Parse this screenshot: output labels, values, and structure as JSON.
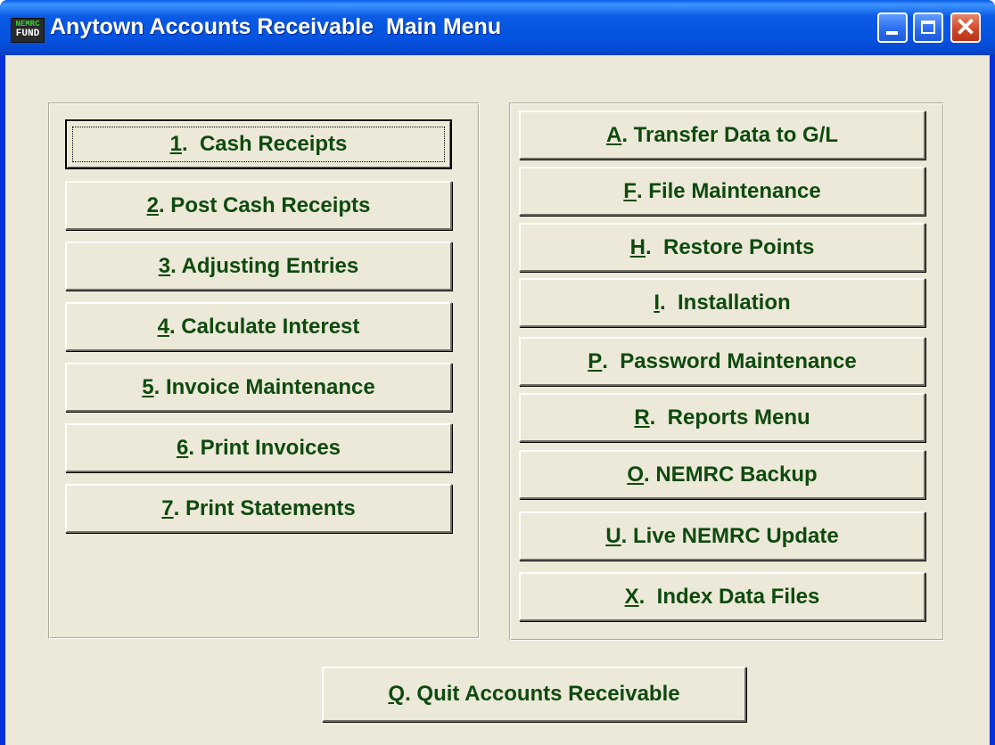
{
  "window": {
    "title": "Anytown Accounts Receivable  Main Menu",
    "icon_top": "NEMRC",
    "icon_bottom": "FUND"
  },
  "left_menu": [
    {
      "key": "1",
      "rest": ".  Cash Receipts"
    },
    {
      "key": "2",
      "rest": ". Post Cash Receipts"
    },
    {
      "key": "3",
      "rest": ". Adjusting Entries"
    },
    {
      "key": "4",
      "rest": ". Calculate Interest"
    },
    {
      "key": "5",
      "rest": ". Invoice Maintenance"
    },
    {
      "key": "6",
      "rest": ". Print Invoices"
    },
    {
      "key": "7",
      "rest": ". Print Statements"
    }
  ],
  "right_menu": [
    {
      "key": "A",
      "rest": ". Transfer Data to G/L"
    },
    {
      "key": "F",
      "rest": ". File Maintenance"
    },
    {
      "key": "H",
      "rest": ".  Restore Points"
    },
    {
      "key": "I",
      "rest": ".  Installation"
    },
    {
      "key": "P",
      "rest": ".  Password Maintenance"
    },
    {
      "key": "R",
      "rest": ".  Reports Menu"
    },
    {
      "key": "O",
      "rest": ". NEMRC Backup"
    },
    {
      "key": "U",
      "rest": ". Live NEMRC Update"
    },
    {
      "key": "X",
      "rest": ".  Index Data Files"
    }
  ],
  "quit": {
    "key": "Q",
    "rest": ". Quit Accounts Receivable"
  }
}
